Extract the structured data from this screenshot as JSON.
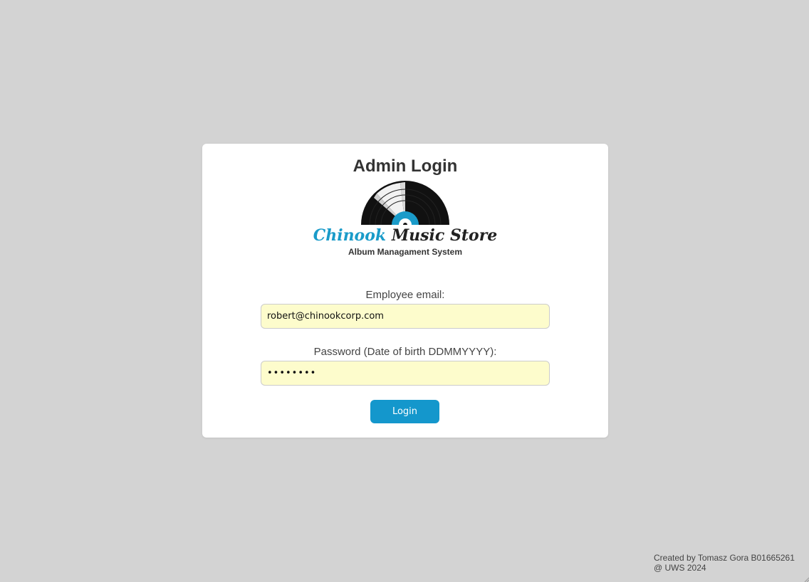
{
  "login_card": {
    "title": "Admin Login",
    "logo": {
      "brand_part1": "Chinook",
      "brand_part2": "Music Store",
      "subtitle": "Album Managament System",
      "icon": "vinyl-record-icon"
    },
    "email": {
      "label": "Employee email:",
      "value": "robert@chinookcorp.com"
    },
    "password": {
      "label": "Password (Date of birth DDMMYYYY):",
      "value": "12345678"
    },
    "login_button": "Login"
  },
  "footer": {
    "line1": "Created by Tomasz Gora B01665261",
    "line2": "@ UWS 2024"
  },
  "colors": {
    "background": "#d3d3d3",
    "card": "#ffffff",
    "accent": "#1497cc",
    "brand_blue": "#1a9bc9",
    "input_fill": "#fdfccc"
  }
}
